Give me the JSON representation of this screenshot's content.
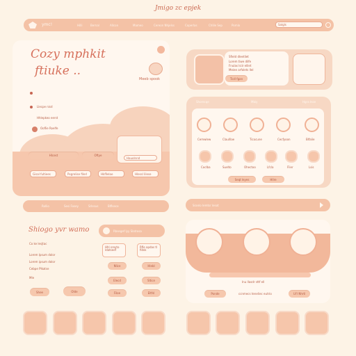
{
  "app": {
    "title_top": "Jmigo zc epjek",
    "logo_text": "ymc!",
    "nav": [
      "Hilli",
      "Bernal",
      "Allcon",
      "Mameo",
      "Cereon Nhjelss",
      "Coperlas",
      "Chlile Sep",
      "Pomlo"
    ],
    "search_placeholder": "Salgls"
  },
  "hero": {
    "title_line1": "Cozy mphkit",
    "title_line2": "ftiuke ..",
    "bubble_text": "Meeb spook",
    "bullets": [
      "Llecpe nisd",
      "Hhlepkeo eerst"
    ],
    "mini_label": "Ooflie Roelfe",
    "button_1": "Hlcest",
    "button_2": "Oftye",
    "selects": [
      "Gisal fultiees",
      "Pxgrelise filerl",
      "Hkfllelae",
      "Hlessl lilese"
    ],
    "small_input": "Hauolnnd"
  },
  "promo": {
    "lines": [
      "Sfield dleetliet",
      "Lorem tiwe dilfe",
      "Fnulas lsiir elilet",
      "Meiee arfolets llel"
    ],
    "button": "Tioll fgan"
  },
  "gallery": {
    "tabs": [
      "Shorecqe",
      "Mbiy",
      "Hgra lnse"
    ],
    "row1": [
      "Cemwlew",
      "Claulllae",
      "Ticocune",
      "Cecfyoon",
      "Blfalie"
    ],
    "row2": [
      "Coclba",
      "Suelto",
      "Ohectoo",
      "Lfcla",
      "Flier",
      "Lsis"
    ],
    "button_1": "Seqt leyes",
    "button_2": "Hllre"
  },
  "left_panel": {
    "tabs": [
      "Rollio",
      "Sesi Fosey",
      "Srlesus",
      "Blflsece"
    ],
    "title": "Shiogo yvr wamo",
    "subtitle": "Co ke lesjtac",
    "lines": [
      "Lorem lpsum dolor",
      "Lorem ipsum dolor ",
      "Cebpe Plkatse"
    ],
    "bottom_label": "Mle",
    "button_1": "Shee",
    "button_2": "Olde",
    "widget_label": "Rbsegef lyy  Slatrosa",
    "buttons_grid": [
      "Hhl sreyto ldatseef",
      "Rfle apdas tl fidsk",
      "Nlice",
      "Hlebl",
      "Elecd",
      "Sltice",
      "Filoe",
      "Eltfsl"
    ]
  },
  "right_panel": {
    "top_bar_text": "Sranlo lemtsr lesot",
    "caption": "Inu llasdr sttf ell",
    "footer_text": "Ponde",
    "footer_text_2": "ccnmecs teneliec eutrio",
    "footer_button": "Ui'l Nhrtl"
  },
  "colors": {
    "bg": "#fdf3e6",
    "peach": "#f4c2a6",
    "soft": "#f7d8c4",
    "accent": "#e9a88b",
    "text": "#b65d45"
  }
}
